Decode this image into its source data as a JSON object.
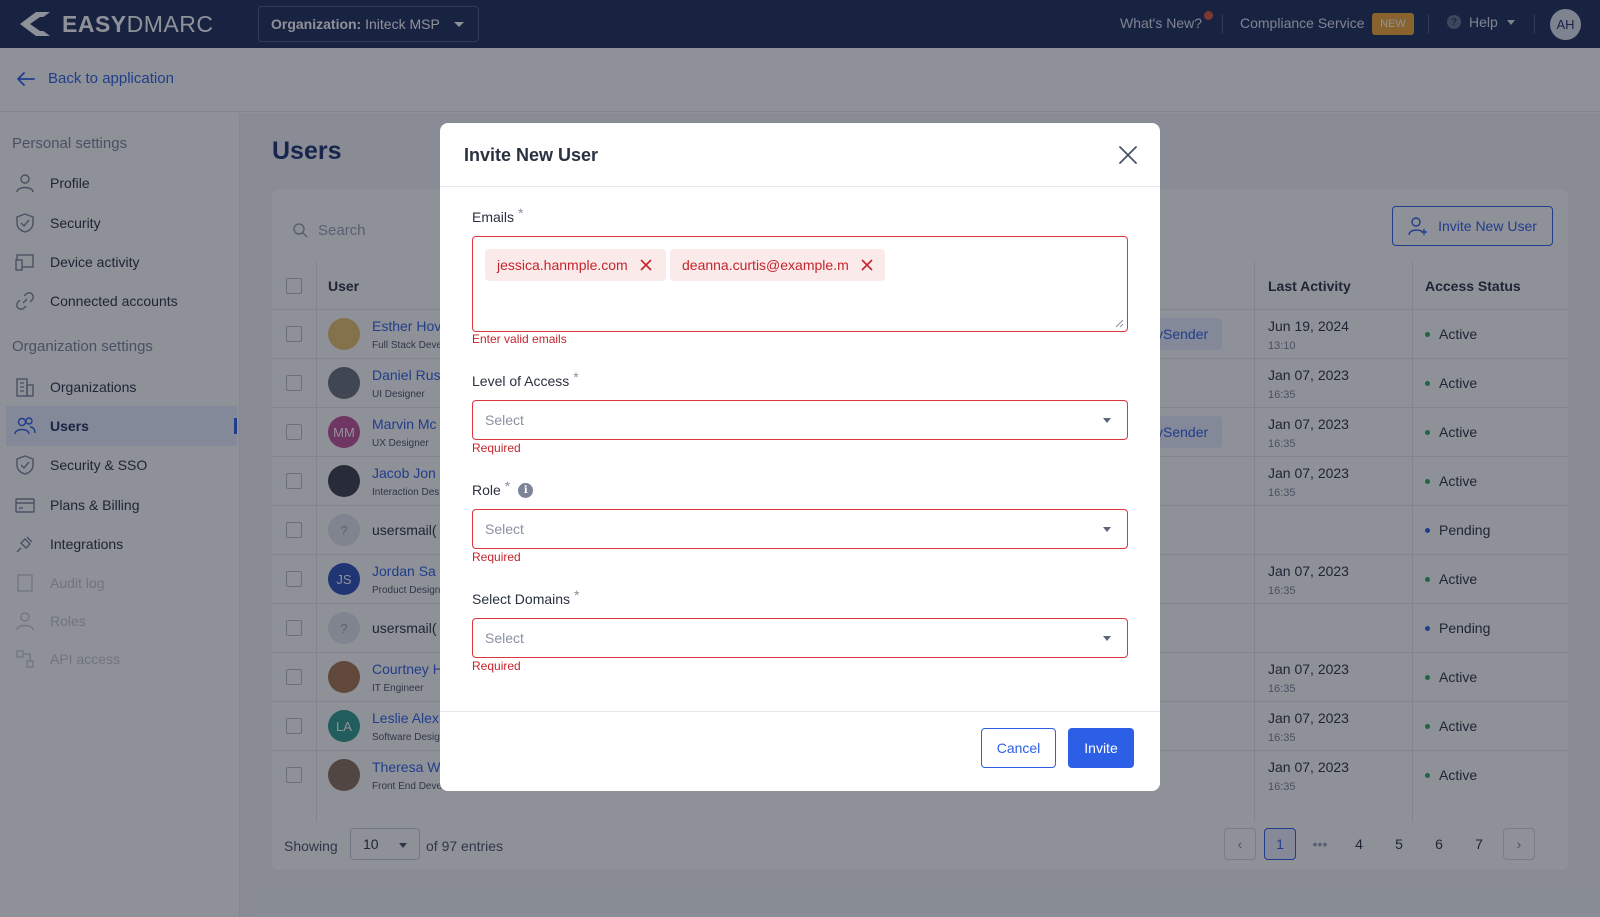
{
  "header": {
    "logo_bold": "EASY",
    "logo_light": "DMARC",
    "org_label": "Organization:",
    "org_value": "Initeck MSP",
    "whats_new": "What's New?",
    "compliance": "Compliance Service",
    "new_badge": "NEW",
    "help": "Help",
    "avatar_initials": "AH"
  },
  "back_link": "Back to application",
  "sidebar": {
    "personal_title": "Personal settings",
    "org_title": "Organization settings",
    "items": [
      {
        "label": "Profile",
        "icon": "user-icon"
      },
      {
        "label": "Security",
        "icon": "shield-icon"
      },
      {
        "label": "Device activity",
        "icon": "devices-icon"
      },
      {
        "label": "Connected accounts",
        "icon": "link-icon"
      },
      {
        "label": "Organizations",
        "icon": "building-icon"
      },
      {
        "label": "Users",
        "icon": "users-icon",
        "active": true
      },
      {
        "label": "Security & SSO",
        "icon": "shield-icon"
      },
      {
        "label": "Plans & Billing",
        "icon": "card-icon"
      },
      {
        "label": "Integrations",
        "icon": "plug-icon"
      },
      {
        "label": "Audit log",
        "icon": "audit-icon",
        "disabled": true
      },
      {
        "label": "Roles",
        "icon": "user-icon",
        "disabled": true
      },
      {
        "label": "API access",
        "icon": "api-icon",
        "disabled": true
      }
    ]
  },
  "users_page": {
    "title": "Users",
    "search_placeholder": "Search",
    "invite_button": "Invite New User",
    "columns": {
      "user": "User",
      "last_activity": "Last Activity",
      "access_status": "Access Status"
    },
    "rows": [
      {
        "name": "Esther Hov",
        "role": "Full Stack Deve",
        "pill": "ySender",
        "date": "Jun 19, 2024",
        "time": "13:10",
        "status": "Active"
      },
      {
        "name": "Daniel Rus",
        "role": "UI Designer",
        "pill": "",
        "date": "Jan 07, 2023",
        "time": "16:35",
        "status": "Active"
      },
      {
        "name": "Marvin Mc",
        "role": "UX Designer",
        "initials": "MM",
        "pill": "ySender",
        "date": "Jan 07, 2023",
        "time": "16:35",
        "status": "Active"
      },
      {
        "name": "Jacob Jon",
        "role": "Interaction Des",
        "pill": "",
        "date": "Jan 07, 2023",
        "time": "16:35",
        "status": "Active"
      },
      {
        "email": "usersmail(",
        "initials": "?",
        "date": "",
        "time": "",
        "status": "Pending"
      },
      {
        "name": "Jordan Sa",
        "role": "Product Design",
        "initials": "JS",
        "date": "Jan 07, 2023",
        "time": "16:35",
        "status": "Active"
      },
      {
        "email": "usersmail(",
        "initials": "?",
        "date": "",
        "time": "",
        "status": "Pending"
      },
      {
        "name": "Courtney H",
        "role": "IT Engineer",
        "date": "Jan 07, 2023",
        "time": "16:35",
        "status": "Active"
      },
      {
        "name": "Leslie Alex",
        "role": "Software Desig",
        "initials": "LA",
        "date": "Jan 07, 2023",
        "time": "16:35",
        "status": "Active"
      },
      {
        "name": "Theresa W",
        "role": "Front End Developer",
        "date": "Jan 07, 2023",
        "time": "16:35",
        "status": "Active"
      }
    ],
    "footer": {
      "showing": "Showing",
      "per_page": "10",
      "entries": "of 97 entries",
      "pages": [
        "1",
        "4",
        "5",
        "6",
        "7"
      ],
      "ellipsis": "•••"
    }
  },
  "modal": {
    "title": "Invite New User",
    "emails_label": "Emails",
    "required_mark": "*",
    "emails": [
      "jessica.hanmple.com",
      "deanna.curtis@example.m"
    ],
    "emails_error": "Enter valid emails",
    "access_label": "Level of Access",
    "role_label": "Role",
    "domains_label": "Select Domains",
    "select_placeholder": "Select",
    "required_error": "Required",
    "cancel": "Cancel",
    "invite": "Invite"
  },
  "colors": {
    "primary": "#2c5fe6",
    "header_bg": "#1c2c5b",
    "error": "#c5252d",
    "active_dot": "#2eaa63",
    "pending_dot": "#2c5fe6"
  }
}
